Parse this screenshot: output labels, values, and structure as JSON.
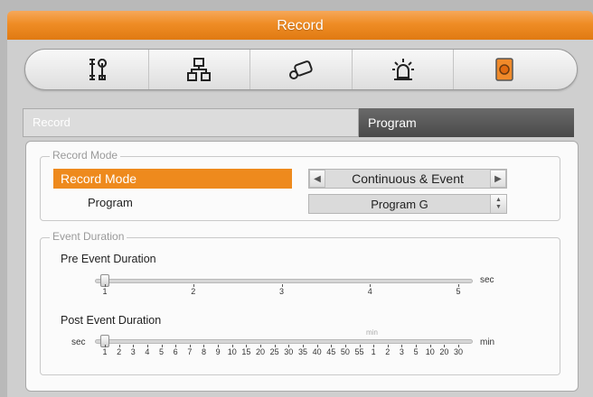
{
  "window": {
    "title": "Record"
  },
  "toolbar": {
    "items": [
      {
        "icon": "tools-icon"
      },
      {
        "icon": "network-icon"
      },
      {
        "icon": "camera-icon"
      },
      {
        "icon": "alarm-icon"
      },
      {
        "icon": "record-icon",
        "active": true
      }
    ]
  },
  "tabs": {
    "record": "Record",
    "program": "Program"
  },
  "record_mode_group": {
    "legend": "Record Mode",
    "record_mode_label": "Record Mode",
    "record_mode_value": "Continuous & Event",
    "program_label": "Program",
    "program_value": "Program G"
  },
  "event_duration_group": {
    "legend": "Event Duration",
    "pre_label": "Pre Event Duration",
    "pre_unit": "sec",
    "pre_ticks": [
      "1",
      "2",
      "3",
      "4",
      "5"
    ],
    "pre_value": 1,
    "post_label": "Post Event Duration",
    "post_unit_left": "sec",
    "post_unit_right": "min",
    "post_min_marker": "min",
    "post_ticks": [
      "1",
      "2",
      "3",
      "4",
      "5",
      "6",
      "7",
      "8",
      "9",
      "10",
      "15",
      "20",
      "25",
      "30",
      "35",
      "40",
      "45",
      "50",
      "55",
      "1",
      "2",
      "3",
      "5",
      "10",
      "20",
      "30"
    ],
    "post_value": "1"
  },
  "colors": {
    "accent": "#ee8a1d",
    "tab_active": "#4f4f4f"
  }
}
